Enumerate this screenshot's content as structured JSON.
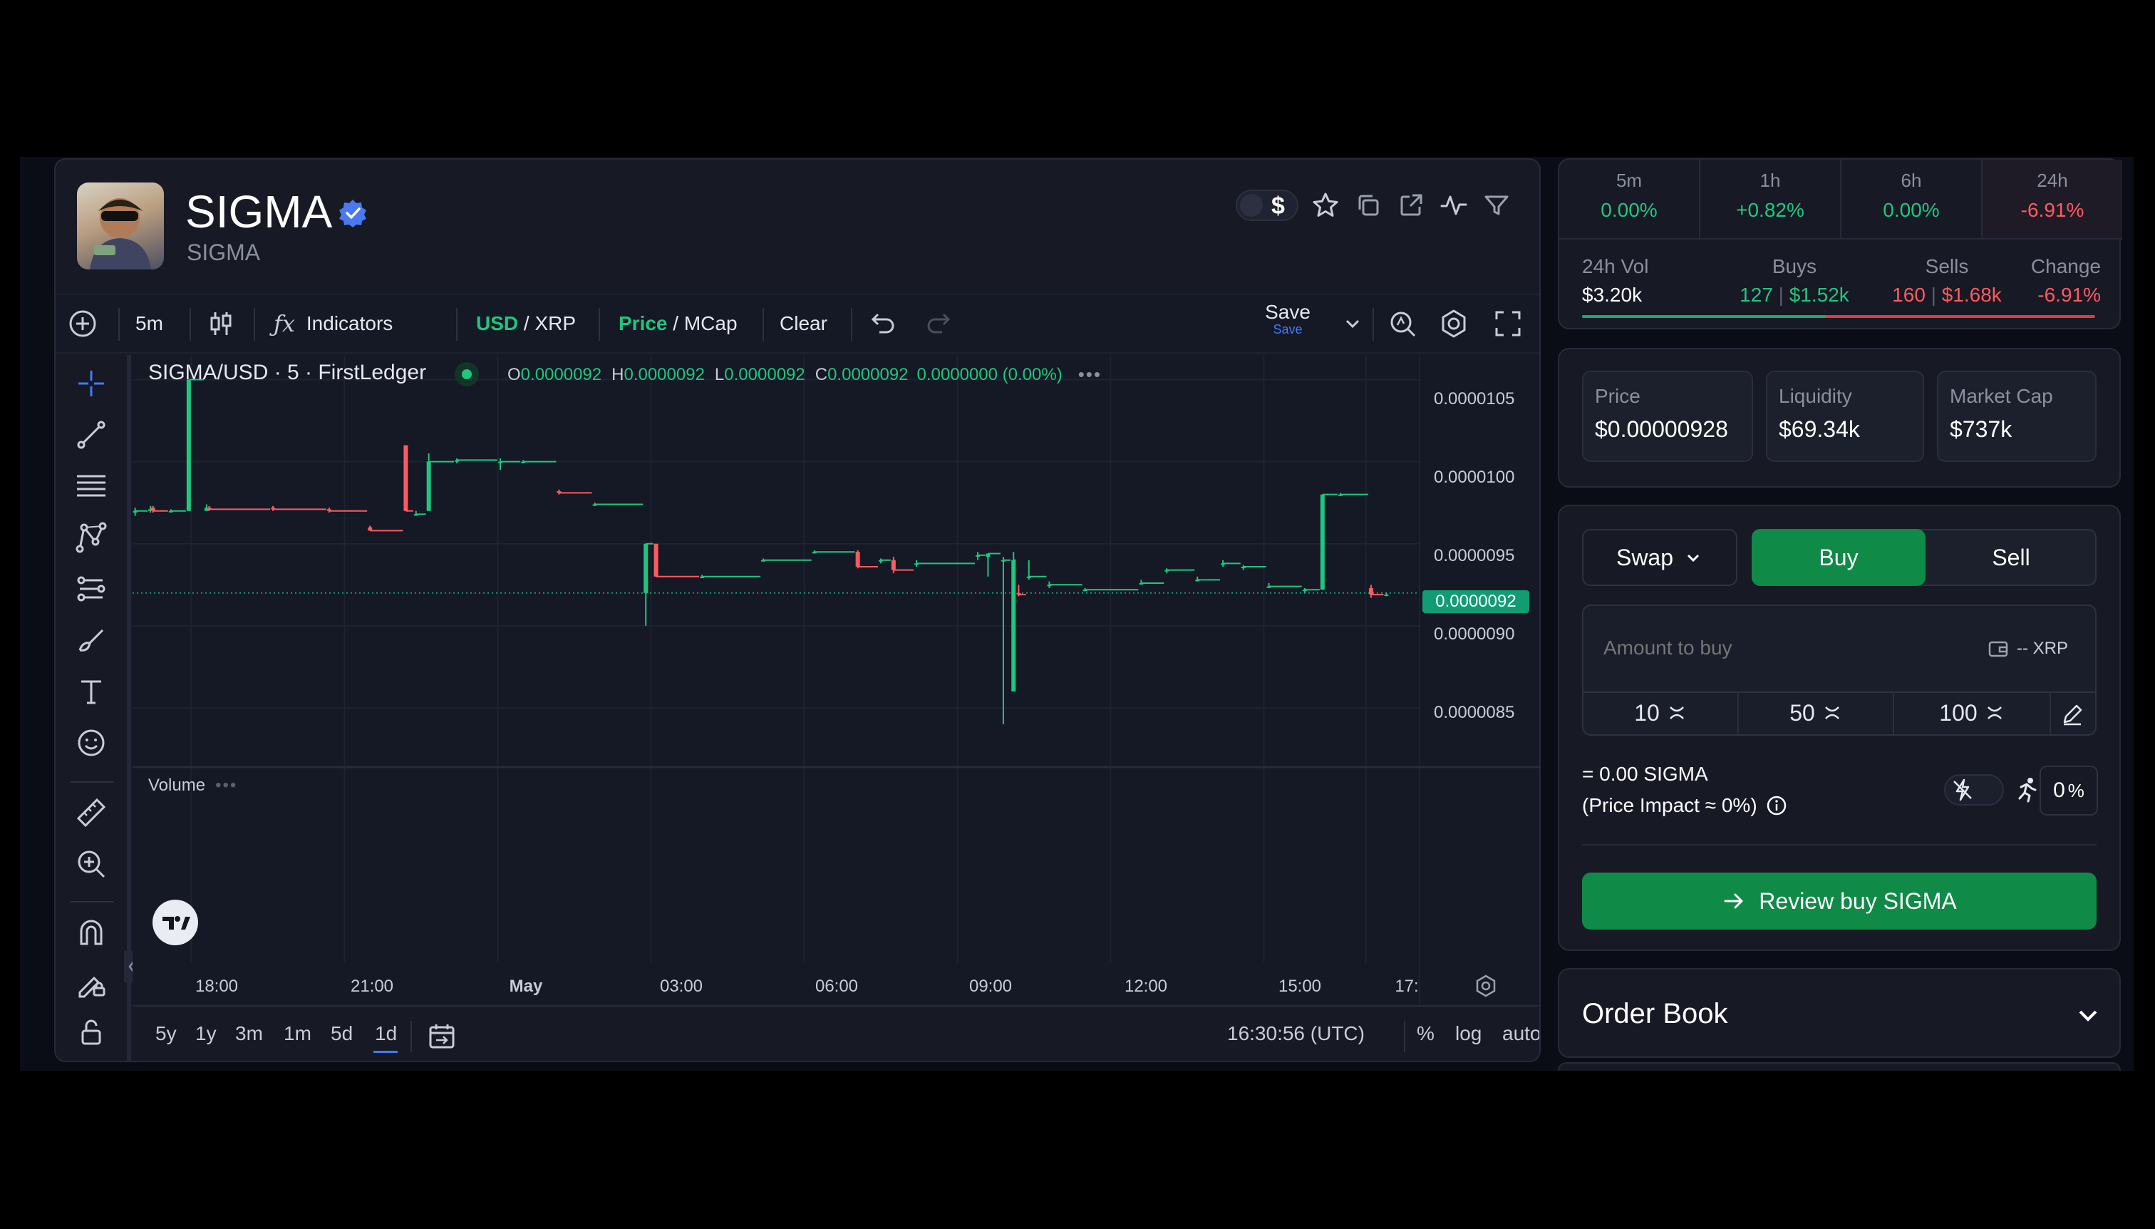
{
  "token": {
    "name": "SIGMA",
    "symbol": "SIGMA",
    "verified": true
  },
  "header_icons": [
    "currency-toggle-icon",
    "star-icon",
    "copy-icon",
    "external-link-icon",
    "activity-icon",
    "filter-icon"
  ],
  "currency_toggle_symbol": "$",
  "toolbar": {
    "interval": "5m",
    "indicators": "Indicators",
    "currency_primary": "USD",
    "currency_slash": " / ",
    "currency_secondary": "XRP",
    "price_primary": "Price",
    "price_slash": " / ",
    "price_secondary": "MCap",
    "clear": "Clear",
    "save": "Save",
    "save_sub": "Save"
  },
  "legend": {
    "title": "SIGMA/USD · 5 · FirstLedger",
    "o_label": "O",
    "o_value": "0.0000092",
    "h_label": "H",
    "h_value": "0.0000092",
    "l_label": "L",
    "l_value": "0.0000092",
    "c_label": "C",
    "c_value": "0.0000092",
    "change": "0.0000000 (0.00%)",
    "volume_label": "Volume"
  },
  "chart_data": {
    "type": "candlestick",
    "symbol": "SIGMA/USD",
    "y_ticks": [
      "0.0000105",
      "0.0000100",
      "0.0000095",
      "0.0000090",
      "0.0000085"
    ],
    "y_tick_values": [
      1.05e-05,
      1e-05,
      9.5e-06,
      9e-06,
      8.5e-06
    ],
    "ylim": [
      8.2e-06,
      1.065e-05
    ],
    "x_ticks": [
      "18:00",
      "21:00",
      "May",
      "03:00",
      "06:00",
      "09:00",
      "12:00",
      "15:00",
      "17:"
    ],
    "x_tick_hours": [
      18,
      21,
      24,
      27,
      30,
      33,
      36,
      39,
      41
    ],
    "xlim": [
      16.85,
      42.05
    ],
    "last_price": "0.0000092",
    "last_price_value": 9.2e-06,
    "candles": [
      {
        "t": 16.9,
        "o": 9.69e-06,
        "h": 9.72e-06,
        "l": 9.67e-06,
        "c": 9.7e-06
      },
      {
        "t": 17.2,
        "o": 9.7e-06,
        "h": 9.73e-06,
        "l": 9.69e-06,
        "c": 9.71e-06
      },
      {
        "t": 17.25,
        "o": 9.72e-06,
        "h": 9.73e-06,
        "l": 9.69e-06,
        "c": 9.7e-06
      },
      {
        "t": 17.6,
        "o": 9.7e-06,
        "h": 9.71e-06,
        "l": 9.69e-06,
        "c": 9.7e-06
      },
      {
        "t": 17.95,
        "o": 9.7e-06,
        "h": 1.05e-05,
        "l": 9.7e-06,
        "c": 1.05e-05
      },
      {
        "t": 18.3,
        "o": 9.7e-06,
        "h": 9.74e-06,
        "l": 9.7e-06,
        "c": 9.72e-06
      },
      {
        "t": 18.35,
        "o": 9.72e-06,
        "h": 9.73e-06,
        "l": 9.7e-06,
        "c": 9.71e-06
      },
      {
        "t": 19.6,
        "o": 9.72e-06,
        "h": 9.73e-06,
        "l": 9.7e-06,
        "c": 9.71e-06
      },
      {
        "t": 20.7,
        "o": 9.71e-06,
        "h": 9.72e-06,
        "l": 9.69e-06,
        "c": 9.7e-06
      },
      {
        "t": 21.5,
        "o": 9.6e-06,
        "h": 9.61e-06,
        "l": 9.58e-06,
        "c": 9.58e-06
      },
      {
        "t": 22.2,
        "o": 1.01e-05,
        "h": 1.01e-05,
        "l": 9.7e-06,
        "c": 9.7e-06
      },
      {
        "t": 22.4,
        "o": 9.68e-06,
        "h": 9.7e-06,
        "l": 9.67e-06,
        "c": 9.68e-06
      },
      {
        "t": 22.65,
        "o": 9.7e-06,
        "h": 1.005e-05,
        "l": 9.7e-06,
        "c": 1e-05
      },
      {
        "t": 23.2,
        "o": 1e-05,
        "h": 1.002e-05,
        "l": 9.99e-06,
        "c": 1.001e-05
      },
      {
        "t": 24.05,
        "o": 1e-05,
        "h": 1.002e-05,
        "l": 9.95e-06,
        "c": 1e-05
      },
      {
        "t": 24.5,
        "o": 1e-05,
        "h": 1.001e-05,
        "l": 9.99e-06,
        "c": 1e-05
      },
      {
        "t": 25.2,
        "o": 9.82e-06,
        "h": 9.83e-06,
        "l": 9.8e-06,
        "c": 9.81e-06
      },
      {
        "t": 25.9,
        "o": 9.74e-06,
        "h": 9.75e-06,
        "l": 9.73e-06,
        "c": 9.74e-06
      },
      {
        "t": 26.9,
        "o": 9.2e-06,
        "h": 9.5e-06,
        "l": 9e-06,
        "c": 9.5e-06
      },
      {
        "t": 27.1,
        "o": 9.5e-06,
        "h": 9.5e-06,
        "l": 9.3e-06,
        "c": 9.3e-06
      },
      {
        "t": 28.0,
        "o": 9.3e-06,
        "h": 9.31e-06,
        "l": 9.29e-06,
        "c": 9.3e-06
      },
      {
        "t": 29.2,
        "o": 9.4e-06,
        "h": 9.41e-06,
        "l": 9.39e-06,
        "c": 9.4e-06
      },
      {
        "t": 30.2,
        "o": 9.45e-06,
        "h": 9.46e-06,
        "l": 9.44e-06,
        "c": 9.45e-06
      },
      {
        "t": 31.05,
        "o": 9.45e-06,
        "h": 9.46e-06,
        "l": 9.35e-06,
        "c": 9.36e-06
      },
      {
        "t": 31.5,
        "o": 9.4e-06,
        "h": 9.41e-06,
        "l": 9.38e-06,
        "c": 9.4e-06
      },
      {
        "t": 31.75,
        "o": 9.4e-06,
        "h": 9.42e-06,
        "l": 9.32e-06,
        "c": 9.34e-06
      },
      {
        "t": 32.2,
        "o": 9.38e-06,
        "h": 9.4e-06,
        "l": 9.36e-06,
        "c": 9.38e-06
      },
      {
        "t": 33.4,
        "o": 9.43e-06,
        "h": 9.45e-06,
        "l": 9.4e-06,
        "c": 9.43e-06
      },
      {
        "t": 33.6,
        "o": 9.42e-06,
        "h": 9.44e-06,
        "l": 9.3e-06,
        "c": 9.44e-06
      },
      {
        "t": 33.9,
        "o": 9.4e-06,
        "h": 9.42e-06,
        "l": 8.4e-06,
        "c": 9.4e-06
      },
      {
        "t": 34.1,
        "o": 8.6e-06,
        "h": 9.45e-06,
        "l": 8.6e-06,
        "c": 9.4e-06
      },
      {
        "t": 34.2,
        "o": 9.2e-06,
        "h": 9.25e-06,
        "l": 9.18e-06,
        "c": 9.19e-06
      },
      {
        "t": 34.4,
        "o": 9.3e-06,
        "h": 9.4e-06,
        "l": 9.28e-06,
        "c": 9.3e-06
      },
      {
        "t": 34.8,
        "o": 9.25e-06,
        "h": 9.27e-06,
        "l": 9.23e-06,
        "c": 9.25e-06
      },
      {
        "t": 35.5,
        "o": 9.22e-06,
        "h": 9.23e-06,
        "l": 9.21e-06,
        "c": 9.22e-06
      },
      {
        "t": 36.6,
        "o": 9.26e-06,
        "h": 9.28e-06,
        "l": 9.25e-06,
        "c": 9.26e-06
      },
      {
        "t": 37.1,
        "o": 9.34e-06,
        "h": 9.35e-06,
        "l": 9.32e-06,
        "c": 9.34e-06
      },
      {
        "t": 37.7,
        "o": 9.28e-06,
        "h": 9.3e-06,
        "l": 9.27e-06,
        "c": 9.28e-06
      },
      {
        "t": 38.2,
        "o": 9.38e-06,
        "h": 9.4e-06,
        "l": 9.36e-06,
        "c": 9.38e-06
      },
      {
        "t": 38.6,
        "o": 9.36e-06,
        "h": 9.37e-06,
        "l": 9.34e-06,
        "c": 9.36e-06
      },
      {
        "t": 39.1,
        "o": 9.24e-06,
        "h": 9.26e-06,
        "l": 9.23e-06,
        "c": 9.24e-06
      },
      {
        "t": 39.8,
        "o": 9.22e-06,
        "h": 9.23e-06,
        "l": 9.2e-06,
        "c": 9.22e-06
      },
      {
        "t": 40.15,
        "o": 9.22e-06,
        "h": 9.8e-06,
        "l": 9.22e-06,
        "c": 9.8e-06
      },
      {
        "t": 40.5,
        "o": 9.8e-06,
        "h": 9.81e-06,
        "l": 9.79e-06,
        "c": 9.8e-06
      },
      {
        "t": 41.1,
        "o": 9.23e-06,
        "h": 9.25e-06,
        "l": 9.17e-06,
        "c": 9.19e-06
      },
      {
        "t": 41.4,
        "o": 9.19e-06,
        "h": 9.2e-06,
        "l": 9.18e-06,
        "c": 9.19e-06
      }
    ]
  },
  "bottom_bar": {
    "ranges": [
      "5y",
      "1y",
      "3m",
      "1m",
      "5d",
      "1d"
    ],
    "active_range": "1d",
    "clock": "16:30:56 (UTC)",
    "percent": "%",
    "log": "log",
    "auto": "auto"
  },
  "stats": {
    "periods": [
      {
        "label": "5m",
        "value": "0.00%",
        "tone": "green"
      },
      {
        "label": "1h",
        "value": "+0.82%",
        "tone": "green"
      },
      {
        "label": "6h",
        "value": "0.00%",
        "tone": "green"
      },
      {
        "label": "24h",
        "value": "-6.91%",
        "tone": "red"
      }
    ],
    "vol_label": "24h Vol",
    "vol_value": "$3.20k",
    "buys_label": "Buys",
    "buys_count": "127",
    "buys_value": "$1.52k",
    "sells_label": "Sells",
    "sells_count": "160",
    "sells_value": "$1.68k",
    "change_label": "Change",
    "change_value": "-6.91%",
    "buy_share": 0.475
  },
  "market": {
    "price_label": "Price",
    "price_value": "$0.00000928",
    "liquidity_label": "Liquidity",
    "liquidity_value": "$69.34k",
    "mcap_label": "Market Cap",
    "mcap_value": "$737k"
  },
  "trade": {
    "mode": "Swap",
    "buy_tab": "Buy",
    "sell_tab": "Sell",
    "amount_placeholder": "Amount to buy",
    "balance": "-- XRP",
    "quick_amounts": [
      "10",
      "50",
      "100"
    ],
    "receive": "= 0.00 SIGMA",
    "impact": "(Price Impact ≈ 0%)",
    "slippage": "0",
    "slippage_unit": "%",
    "review_label": "Review buy SIGMA",
    "accent": "#0f8a47"
  },
  "order_book": {
    "title": "Order Book"
  },
  "colors": {
    "up": "#1fc77e",
    "down": "#ff5a5f",
    "accent_blue": "#3f7cff",
    "panel": "#171925",
    "chart_bg": "#151825"
  }
}
